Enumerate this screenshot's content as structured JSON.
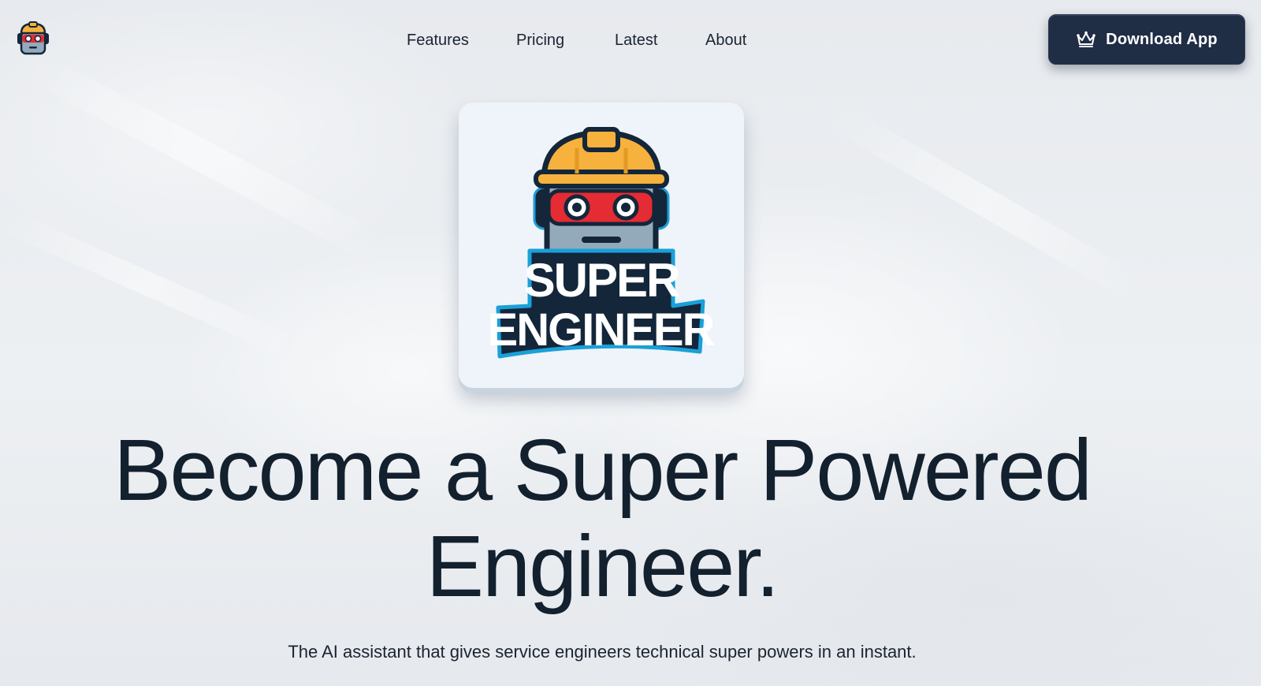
{
  "nav": {
    "items": [
      {
        "label": "Features"
      },
      {
        "label": "Pricing"
      },
      {
        "label": "Latest"
      },
      {
        "label": "About"
      }
    ],
    "download_button": {
      "label": "Download App",
      "icon": "crown-icon"
    }
  },
  "hero": {
    "logo_text_line1": "SUPER",
    "logo_text_line2": "ENGINEER",
    "headline_line1": "Become a Super Powered",
    "headline_line2": "Engineer.",
    "subtitle": "The AI assistant that gives service engineers technical super powers in an instant."
  },
  "colors": {
    "background": "#e9ecef",
    "text": "#13202e",
    "button": "#1f2d45",
    "helmet": "#f6b23c",
    "mask": "#e52b33",
    "robot_face": "#93aabb",
    "logo_outline": "#1aa0d8",
    "logo_dark": "#14263a"
  }
}
